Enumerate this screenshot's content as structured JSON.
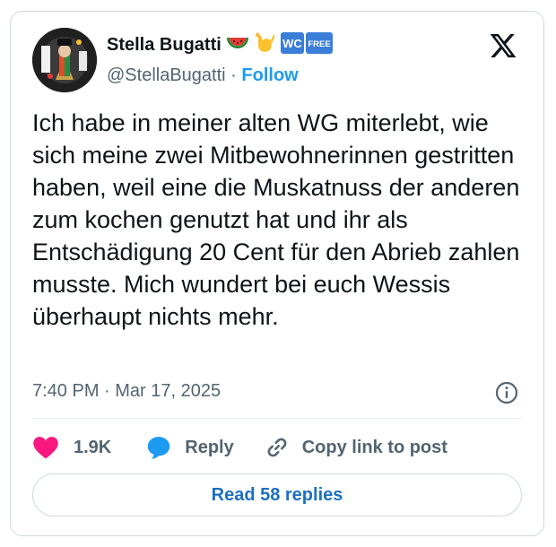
{
  "author": {
    "name": "Stella Bugatti",
    "handle": "@StellaBugatti",
    "separator": "·",
    "follow_label": "Follow",
    "name_emojis": [
      "watermelon-icon",
      "call-me-hand-icon",
      "wc-sign-icon",
      "free-sign-icon"
    ],
    "wc_text": "WC",
    "free_text": "FREE"
  },
  "tweet": {
    "text": "Ich habe in meiner alten WG miterlebt, wie sich meine zwei Mitbewohnerinnen gestritten haben, weil eine die Muskatnuss der anderen zum kochen genutzt hat und ihr als Entschädigung 20 Cent für den Abrieb zahlen musste. Mich wundert bei euch Wessis überhaupt nichts mehr.",
    "timestamp": "7:40 PM · Mar 17, 2025"
  },
  "actions": {
    "like_count": "1.9K",
    "reply_label": "Reply",
    "copy_label": "Copy link to post"
  },
  "read_replies_label": "Read 58 replies",
  "colors": {
    "text": "#0f1419",
    "secondary": "#536471",
    "accent": "#1d9bf0",
    "heart": "#f91880",
    "border": "#cfd9de"
  }
}
